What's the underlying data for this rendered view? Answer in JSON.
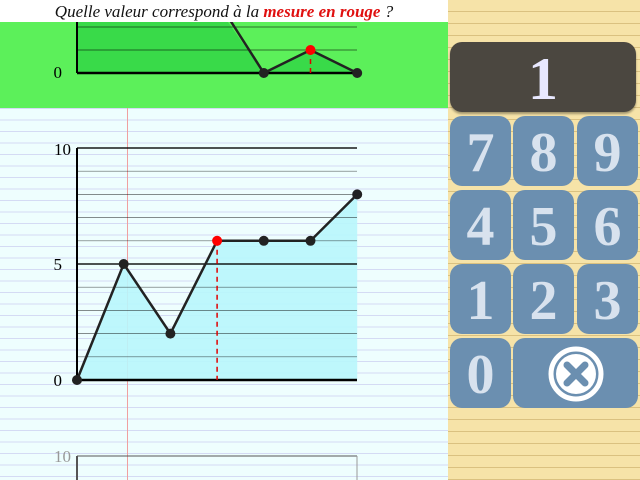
{
  "question": {
    "before": "Quelle valeur correspond à la ",
    "highlight": "mesure en rouge",
    "after": " ?"
  },
  "keypad": {
    "display": "1",
    "keys": [
      "7",
      "8",
      "9",
      "4",
      "5",
      "6",
      "1",
      "2",
      "3",
      "0"
    ],
    "delete_icon": "close-circle-icon"
  },
  "colors": {
    "green_band": "#5cf05a",
    "highlight": "#e01010",
    "area_fill": "#b8f6fc",
    "marker": "#ff0000",
    "keypad_key": "#6b8fb0",
    "display_bg": "#4b4740"
  },
  "chart_data": [
    {
      "type": "line",
      "x": [
        0,
        1,
        2,
        3,
        4,
        5,
        6
      ],
      "values": [
        5,
        2,
        6,
        6,
        6,
        8
      ],
      "x_start": 1,
      "highlight_x": 3,
      "y_ticks": [
        "0",
        "5",
        "10"
      ],
      "ylim": [
        0,
        10
      ],
      "filled_area": true
    },
    {
      "type": "line",
      "values": [
        0,
        1,
        0
      ],
      "x_start": 4,
      "highlight_x": 5,
      "y_ticks": [
        "0"
      ],
      "filled_area": true
    }
  ],
  "next_chart": {
    "y_ticks": [
      "10"
    ]
  }
}
